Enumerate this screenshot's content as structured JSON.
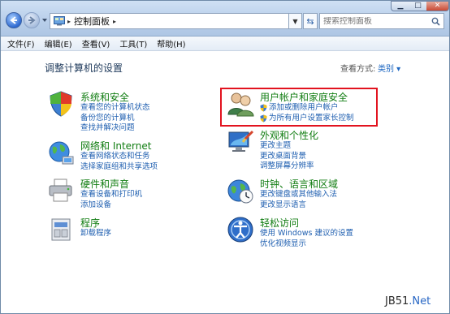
{
  "window": {
    "breadcrumb": "控制面板",
    "search_placeholder": "搜索控制面板"
  },
  "menu": [
    "文件(F)",
    "编辑(E)",
    "查看(V)",
    "工具(T)",
    "帮助(H)"
  ],
  "content": {
    "title": "调整计算机的设置",
    "view_by_label": "查看方式:",
    "view_by_value": "类别 ▾"
  },
  "categories": {
    "system": {
      "title": "系统和安全",
      "links": [
        "查看您的计算机状态",
        "备份您的计算机",
        "查找并解决问题"
      ]
    },
    "network": {
      "title": "网络和 Internet",
      "links": [
        "查看网络状态和任务",
        "选择家庭组和共享选项"
      ]
    },
    "hardware": {
      "title": "硬件和声音",
      "links": [
        "查看设备和打印机",
        "添加设备"
      ]
    },
    "programs": {
      "title": "程序",
      "links": [
        "卸载程序"
      ]
    },
    "users": {
      "title": "用户帐户和家庭安全",
      "links": [
        "添加或删除用户帐户",
        "为所有用户设置家长控制"
      ]
    },
    "appearance": {
      "title": "外观和个性化",
      "links": [
        "更改主题",
        "更改桌面背景",
        "调整屏幕分辨率"
      ]
    },
    "clock": {
      "title": "时钟、语言和区域",
      "links": [
        "更改键盘或其他输入法",
        "更改显示语言"
      ]
    },
    "ease": {
      "title": "轻松访问",
      "links": [
        "使用 Windows 建议的设置",
        "优化视频显示"
      ]
    }
  },
  "watermark": {
    "part1": "JB51",
    "part2": ".Net"
  }
}
